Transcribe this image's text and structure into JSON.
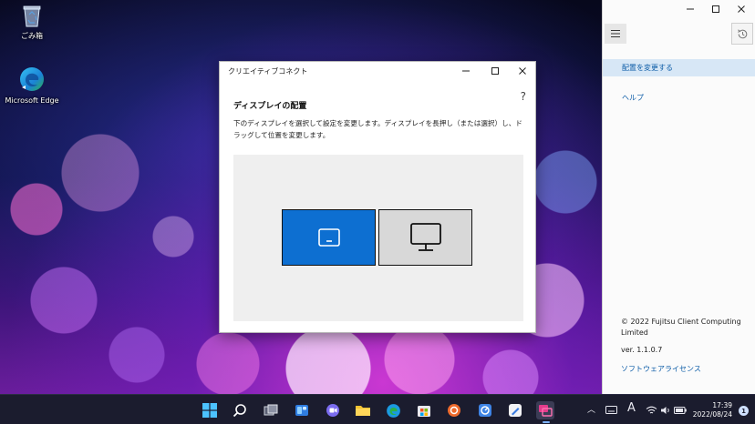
{
  "desktop": {
    "icons": [
      {
        "label": "ごみ箱",
        "icon": "recycle-bin-icon"
      },
      {
        "label": "Microsoft Edge",
        "icon": "edge-icon"
      }
    ]
  },
  "dialog": {
    "title": "クリエイティブコネクト",
    "help": "?",
    "heading": "ディスプレイの配置",
    "description": "下のディスプレイを選択して設定を変更します。ディスプレイを長押し（または選択）し、ドラッグして位置を変更します。",
    "displays": [
      {
        "id": 1,
        "selected": true,
        "icon": "laptop-display-icon"
      },
      {
        "id": 2,
        "selected": false,
        "icon": "monitor-icon"
      }
    ]
  },
  "panel": {
    "nav": [
      {
        "label": "配置を変更する",
        "selected": true
      },
      {
        "label": "ヘルプ",
        "selected": false
      }
    ],
    "copyright": "© 2022 Fujitsu Client Computing Limited",
    "version": "ver.  1.1.0.7",
    "license": "ソフトウェアライセンス"
  },
  "taskbar": {
    "time": "17:39",
    "date": "2022/08/24",
    "notification_count": "1",
    "ime": "A"
  },
  "colors": {
    "accent": "#0d6fd1",
    "link": "#0f5ea8",
    "selection": "#d7e7f6",
    "taskbar": "#1b1c2e"
  }
}
